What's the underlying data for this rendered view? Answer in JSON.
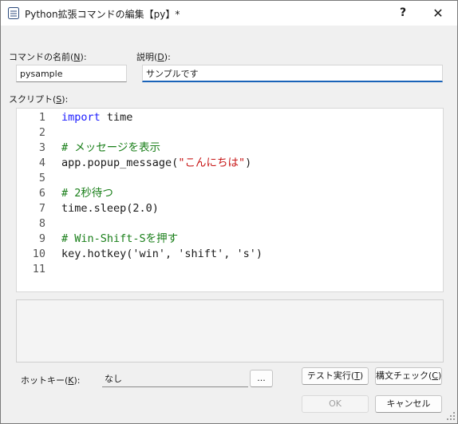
{
  "window": {
    "title": "Python拡張コマンドの編集【py】*",
    "help_label": "?",
    "close_label": "✕"
  },
  "form": {
    "command_name_label": "コマンドの名前(",
    "command_name_key": "N",
    "command_name_suffix": "):",
    "command_name_value": "pysample",
    "description_label": "説明(",
    "description_key": "D",
    "description_suffix": "):",
    "description_value": "サンプルです",
    "script_label": "スクリプト(",
    "script_key": "S",
    "script_suffix": "):"
  },
  "editor": {
    "lines": [
      {
        "n": "1",
        "kw": "import",
        "rest": " time"
      },
      {
        "n": "2"
      },
      {
        "n": "3",
        "comment": "# メッセージを表示"
      },
      {
        "n": "4",
        "pre": "app.popup_message(",
        "str": "\"こんにちは\"",
        "post": ")"
      },
      {
        "n": "5"
      },
      {
        "n": "6",
        "comment": "# 2秒待つ"
      },
      {
        "n": "7",
        "pre": "time.sleep(2.0)"
      },
      {
        "n": "8"
      },
      {
        "n": "9",
        "comment": "# Win-Shift-Sを押す"
      },
      {
        "n": "10",
        "pre": "key.hotkey('win', 'shift', 's')"
      },
      {
        "n": "11"
      }
    ]
  },
  "hotkey": {
    "label_prefix": "ホットキー(",
    "label_key": "K",
    "label_suffix": "):",
    "value": "なし",
    "browse_label": "..."
  },
  "buttons": {
    "test_run": "テスト実行(",
    "test_run_key": "T",
    "test_run_suffix": ")",
    "syntax_check": "構文チェック(",
    "syntax_check_key": "C",
    "syntax_check_suffix": ")",
    "ok": "OK",
    "cancel": "キャンセル"
  },
  "colors": {
    "keyword": "#1a1aff",
    "comment": "#1a7f1a",
    "string": "#c81818",
    "focus_accent": "#1a63b8"
  }
}
